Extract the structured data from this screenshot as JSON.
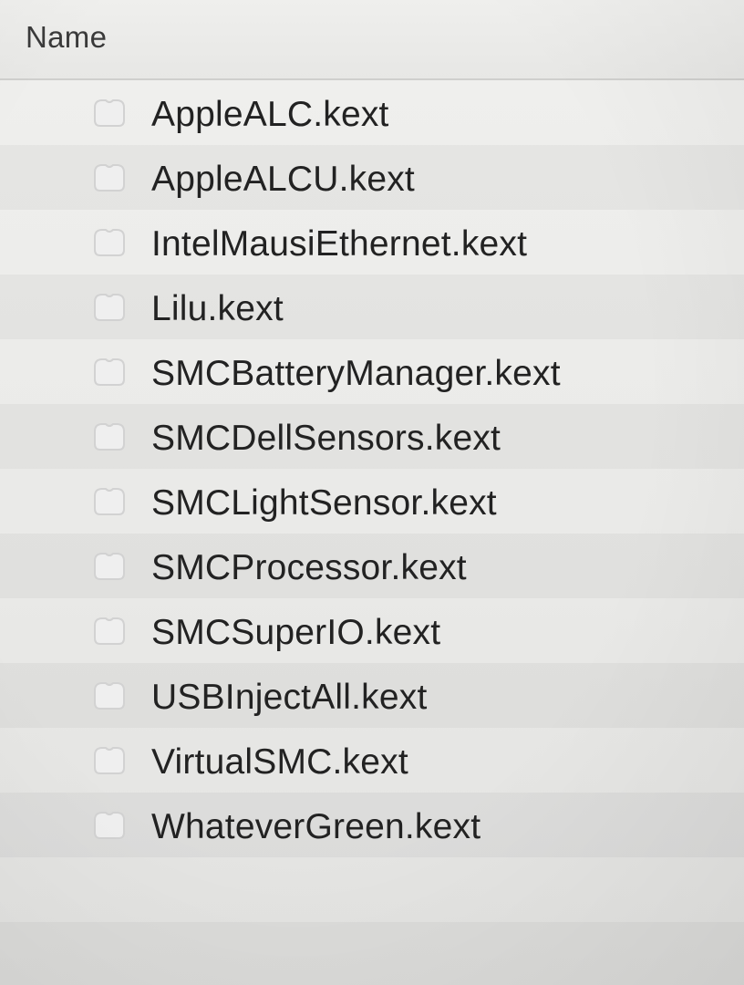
{
  "column_header": "Name",
  "files": [
    {
      "name": "AppleALC.kext",
      "icon": "kext-bundle-icon"
    },
    {
      "name": "AppleALCU.kext",
      "icon": "kext-bundle-icon"
    },
    {
      "name": "IntelMausiEthernet.kext",
      "icon": "kext-bundle-icon"
    },
    {
      "name": "Lilu.kext",
      "icon": "kext-bundle-icon"
    },
    {
      "name": "SMCBatteryManager.kext",
      "icon": "kext-bundle-icon"
    },
    {
      "name": "SMCDellSensors.kext",
      "icon": "kext-bundle-icon"
    },
    {
      "name": "SMCLightSensor.kext",
      "icon": "kext-bundle-icon"
    },
    {
      "name": "SMCProcessor.kext",
      "icon": "kext-bundle-icon"
    },
    {
      "name": "SMCSuperIO.kext",
      "icon": "kext-bundle-icon"
    },
    {
      "name": "USBInjectAll.kext",
      "icon": "kext-bundle-icon"
    },
    {
      "name": "VirtualSMC.kext",
      "icon": "kext-bundle-icon"
    },
    {
      "name": "WhateverGreen.kext",
      "icon": "kext-bundle-icon"
    }
  ]
}
